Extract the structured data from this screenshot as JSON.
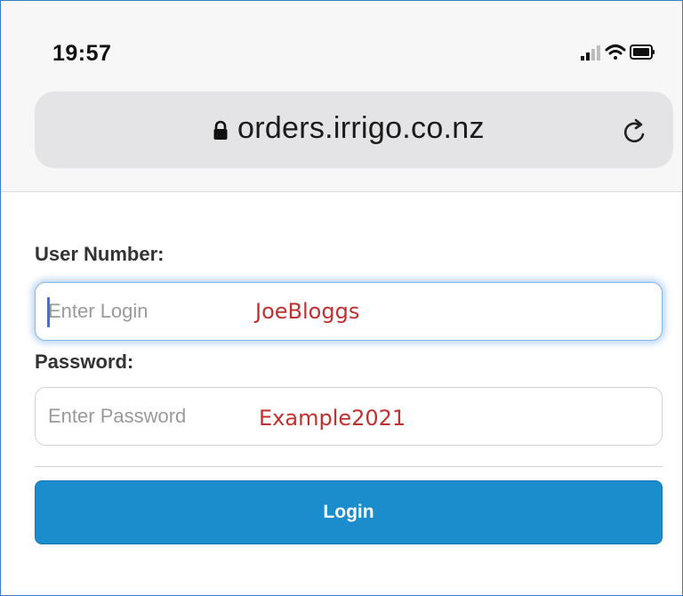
{
  "status_bar": {
    "time": "19:57",
    "icons": [
      "signal-icon",
      "wifi-icon",
      "battery-icon"
    ]
  },
  "address_bar": {
    "url": "orders.irrigo.co.nz",
    "icons": [
      "lock-icon",
      "reload-icon"
    ]
  },
  "form": {
    "user_label": "User Number:",
    "user_placeholder": "Enter Login",
    "user_annotation": "JoeBloggs",
    "password_label": "Password:",
    "password_placeholder": "Enter Password",
    "password_annotation": "Example2021",
    "login_button": "Login"
  },
  "colors": {
    "button": "#1c8dcc",
    "annotation": "#c0302f",
    "focus_ring": "#86b7e6",
    "caret": "#3c6fe0"
  }
}
